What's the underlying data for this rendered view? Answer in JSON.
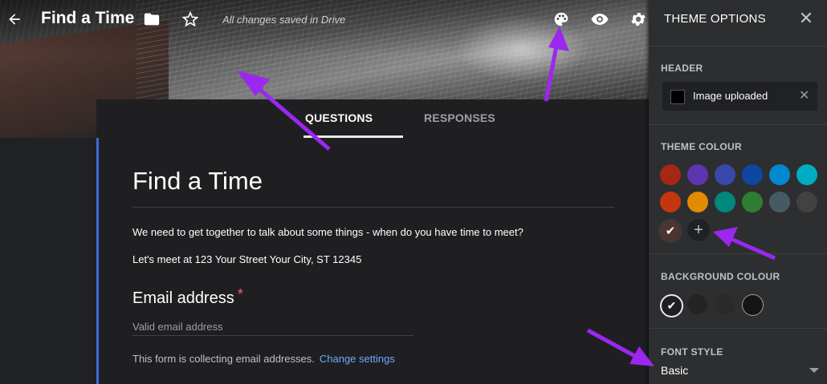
{
  "toolbar": {
    "title": "Find a Time",
    "saved_status": "All changes saved in Drive",
    "icons": [
      "arrow-back-icon",
      "folder-icon",
      "star-icon",
      "palette-icon",
      "eye-icon",
      "gear-icon"
    ]
  },
  "tabs": {
    "questions": "QUESTIONS",
    "responses": "RESPONSES"
  },
  "form": {
    "title": "Find a Time",
    "description_line1": "We need to get together to talk about some things - when do you have time to meet?",
    "description_line2": "Let's meet at 123 Your Street Your City, ST 12345",
    "email_label": "Email address",
    "required_mark": "*",
    "email_placeholder": "Valid email address",
    "collecting_text": "This form is collecting email addresses.",
    "change_settings": "Change settings"
  },
  "theme_panel": {
    "title": "THEME OPTIONS",
    "header_label": "HEADER",
    "image_status": "Image uploaded",
    "theme_colour_label": "THEME COLOUR",
    "theme_colours": [
      "#a52714",
      "#5e35b1",
      "#3949ab",
      "#0d47a1",
      "#0288d1",
      "#00acc1",
      "#c4360d",
      "#e08b00",
      "#00897b",
      "#2e7d32",
      "#455a64",
      "#424242"
    ],
    "selected_theme_colour": "#4e342e",
    "background_colour_label": "BACKGROUND COLOUR",
    "background_colours": [
      "#1f1f22",
      "#242424",
      "#2a2a2a",
      "#151515"
    ],
    "font_style_label": "FONT STYLE",
    "font_style_value": "Basic"
  },
  "colors": {
    "accent_arrow": "#9b27f0",
    "link": "#6fa8ff",
    "card_border": "#3f6ad8"
  }
}
